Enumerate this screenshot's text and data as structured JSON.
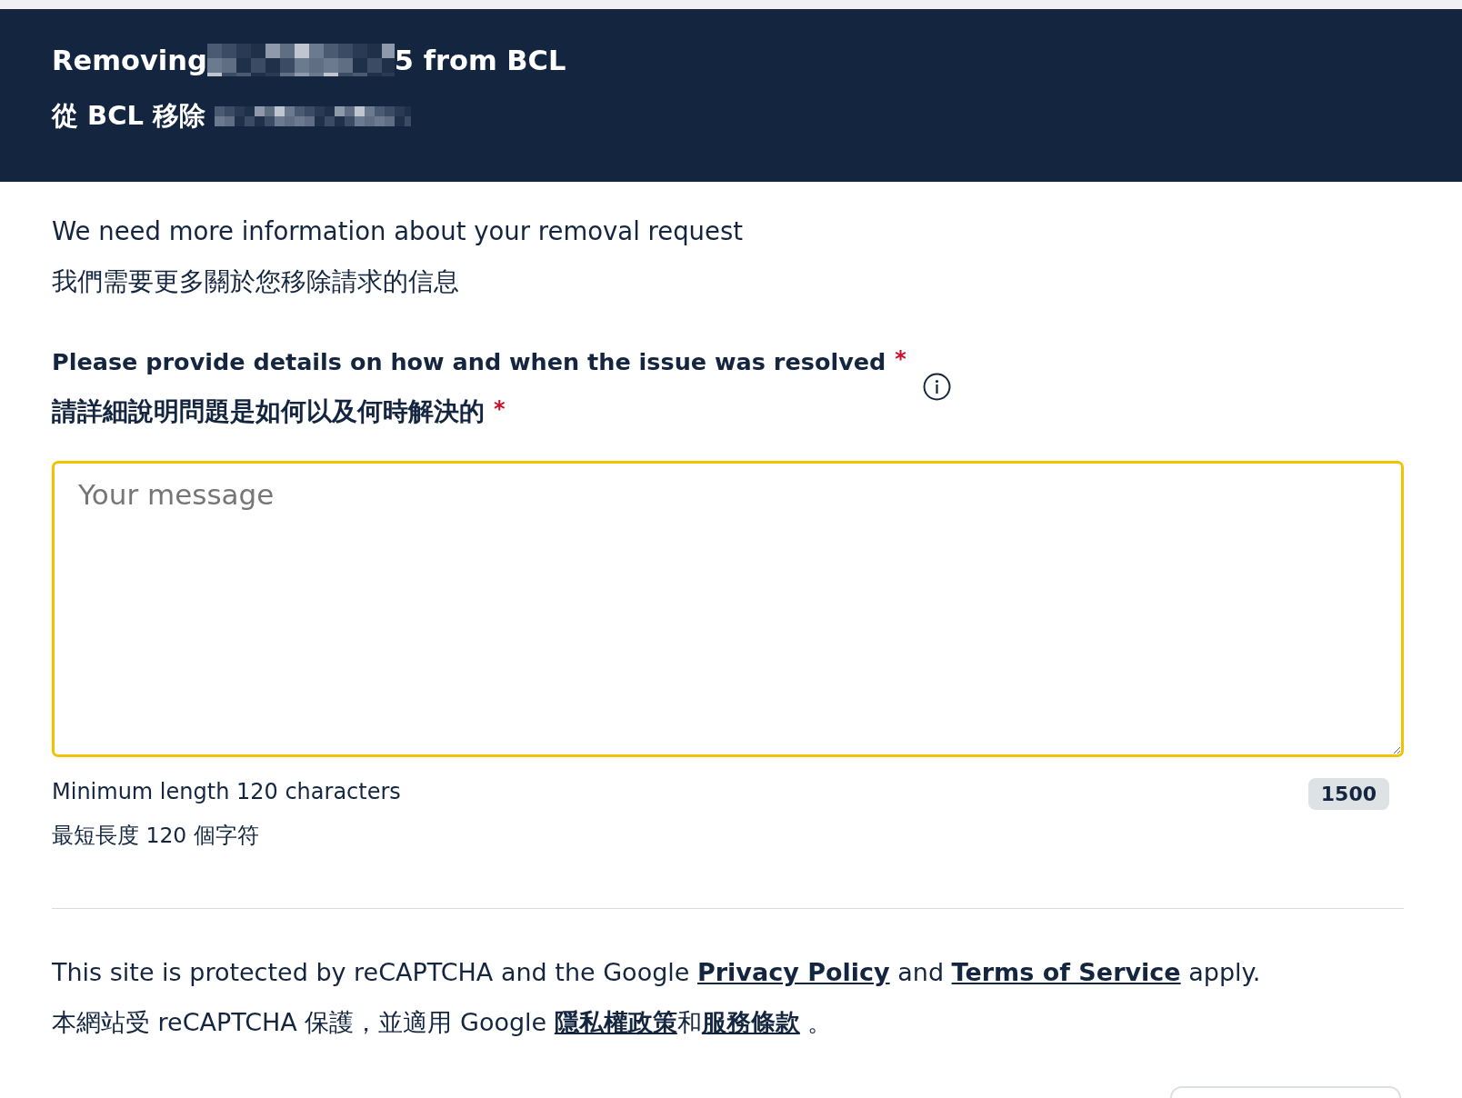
{
  "header": {
    "title": [
      {
        "kind": "text",
        "text": "Removing"
      },
      {
        "kind": "redacted"
      },
      {
        "kind": "text",
        "text": "5 from BCL"
      }
    ],
    "subtitle": [
      {
        "kind": "text",
        "text": "從 BCL 移除"
      },
      {
        "kind": "redacted"
      }
    ]
  },
  "intro": {
    "text": "We need more information about your removal request",
    "text_zh": "我們需要更多關於您移除請求的信息"
  },
  "question": {
    "label": "Please provide details on how and when the issue was resolved",
    "label_zh": "請詳細說明問題是如何以及何時解決的",
    "required_mark": "*",
    "placeholder": "Your message",
    "focused": true,
    "hint": "Minimum length 120 characters",
    "hint_zh": "最短長度 120 個字符",
    "counter": "1500"
  },
  "notice": {
    "lines": [
      [
        {
          "kind": "text",
          "text": "This site is protected by reCAPTCHA and the Google "
        },
        {
          "kind": "link",
          "text": "Privacy Policy"
        },
        {
          "kind": "text",
          "text": " and "
        },
        {
          "kind": "link",
          "text": "Terms of Service"
        },
        {
          "kind": "text",
          "text": " apply."
        }
      ],
      [
        {
          "kind": "text",
          "text": "本網站受 reCAPTCHA 保護，並適用 Google "
        },
        {
          "kind": "link",
          "text": "隱私權政策"
        },
        {
          "kind": "text",
          "text": "和"
        },
        {
          "kind": "link",
          "text": "服務條款"
        },
        {
          "kind": "text",
          "text": " 。"
        }
      ]
    ]
  }
}
